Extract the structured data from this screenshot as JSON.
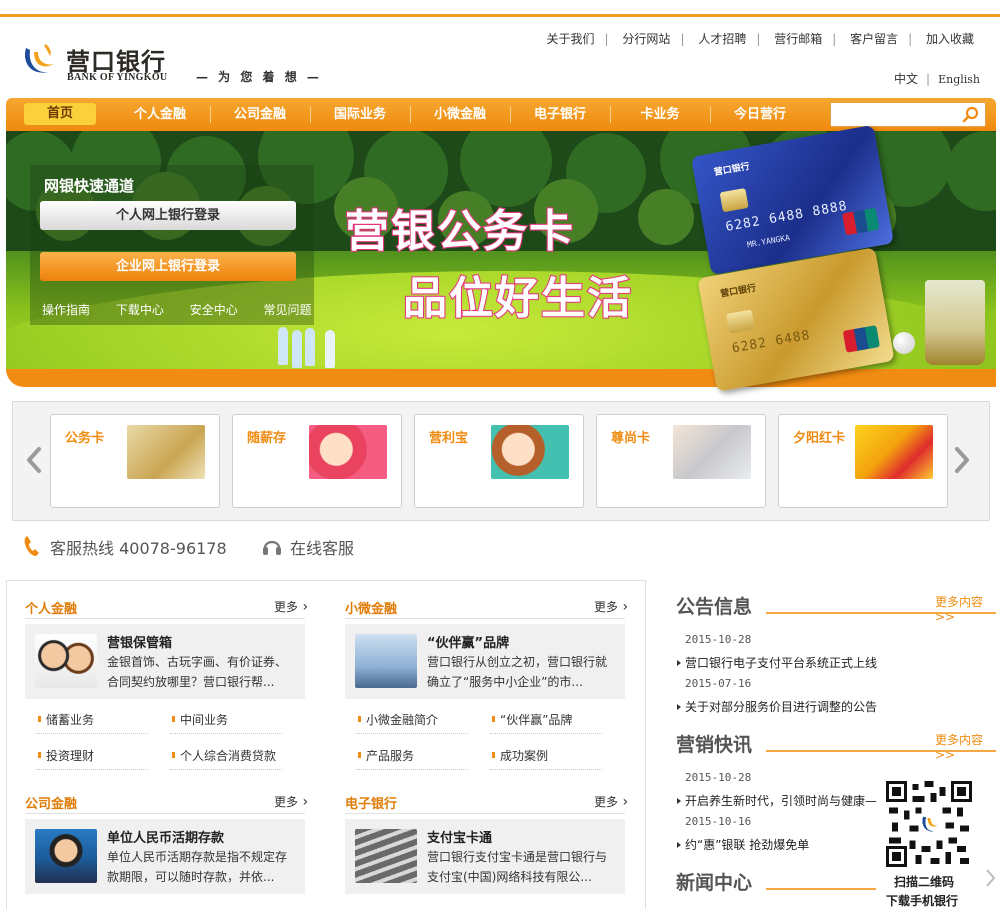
{
  "brand": {
    "name_cn": "营口银行",
    "name_en": "BANK OF YINGKOU",
    "slogan": "— 为 您 着 想 —"
  },
  "top_links": [
    "关于我们",
    "分行网站",
    "人才招聘",
    "营行邮箱",
    "客户留言",
    "加入收藏"
  ],
  "language": {
    "cn": "中文",
    "en": "English"
  },
  "nav": {
    "items": [
      "首页",
      "个人金融",
      "公司金融",
      "国际业务",
      "小微金融",
      "电子银行",
      "卡业务",
      "今日营行"
    ],
    "search_placeholder": ""
  },
  "banner": {
    "quick_title": "网银快速通道",
    "personal_login": "个人网上银行登录",
    "corporate_login": "企业网上银行登录",
    "links": [
      "操作指南",
      "下载中心",
      "安全中心",
      "常见问题"
    ],
    "headline1": "营银公务卡",
    "headline2": "品位好生活",
    "card_blue_number": "6282 6488 8888",
    "card_gold_number": "6282 6488",
    "card_brand": "营口银行",
    "card_holder": "MR.YANGKA"
  },
  "products": [
    "公务卡",
    "随薪存",
    "营利宝",
    "尊尚卡",
    "夕阳红卡"
  ],
  "service": {
    "hotline": "客服热线 40078-96178",
    "online": "在线客服"
  },
  "sections": [
    {
      "title": "个人金融",
      "more": "更多",
      "feature_title": "营银保管箱",
      "feature_desc": "金银首饰、古玩字画、有价证券、合同契约放哪里？营口银行帮...",
      "links": [
        "储蓄业务",
        "中间业务",
        "投资理财",
        "个人综合消费贷款"
      ]
    },
    {
      "title": "小微金融",
      "more": "更多",
      "feature_title": "“伙伴赢”品牌",
      "feature_desc": "营口银行从创立之初，营口银行就确立了“服务中小企业”的市...",
      "links": [
        "小微金融简介",
        "“伙伴赢”品牌",
        "产品服务",
        "成功案例"
      ]
    },
    {
      "title": "公司金融",
      "more": "更多",
      "feature_title": "单位人民币活期存款",
      "feature_desc": "单位人民币活期存款是指不规定存款期限，可以随时存款，并依...",
      "links": []
    },
    {
      "title": "电子银行",
      "more": "更多",
      "feature_title": "支付宝卡通",
      "feature_desc": "营口银行支付宝卡通是营口银行与支付宝(中国)网络科技有限公...",
      "links": []
    }
  ],
  "notices": {
    "title": "公告信息",
    "more": "更多内容",
    "items": [
      {
        "date": "2015-10-28",
        "text": "营口银行电子支付平台系统正式上线"
      },
      {
        "date": "2015-07-16",
        "text": "关于对部分服务价目进行调整的公告"
      }
    ]
  },
  "marketing": {
    "title": "营销快讯",
    "more": "更多内容",
    "items": [
      {
        "date": "2015-10-28",
        "text": "开启养生新时代，引领时尚与健康—"
      },
      {
        "date": "2015-10-16",
        "text": "约“惠”银联 抢劲爆免单"
      }
    ]
  },
  "news": {
    "title": "新闻中心"
  },
  "qr": {
    "caption1": "扫描二维码",
    "caption2": "下载手机银行"
  },
  "colors": {
    "accent": "#f08c12",
    "nav_active": "#fad13b",
    "headline_pink": "#e6357f"
  }
}
